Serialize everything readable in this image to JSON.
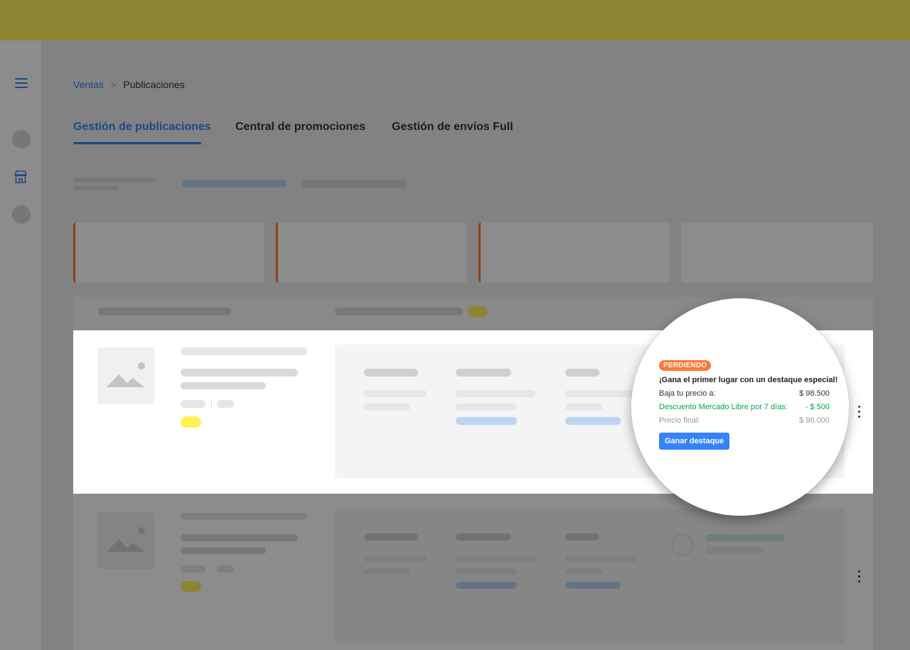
{
  "colors": {
    "topbar": "#fff159",
    "accent_blue": "#3483fa",
    "card_accent": "#ff7733",
    "success_green": "#00a650",
    "tag_yellow": "#fff159"
  },
  "sidebar": {
    "icons": [
      "menu-icon",
      "store-icon"
    ]
  },
  "breadcrumb": {
    "parent": "Ventas",
    "separator": ">",
    "current": "Publicaciones"
  },
  "tabs": [
    {
      "label": "Gestión de publicaciones",
      "active": true
    },
    {
      "label": "Central de promociones",
      "active": false
    },
    {
      "label": "Gestión de envíos Full",
      "active": false
    }
  ],
  "promo": {
    "status_badge": "PERDIENDO",
    "title": "¡Gana el primer lugar con un destaque especial!",
    "price_label": "Baja tu precio a:",
    "price_value": "$ 98.500",
    "discount_label": "Descuento Mercado Libre por 7 días:",
    "discount_value": "- $ 500",
    "final_label": "Precio final:",
    "final_value": "$ 98.000",
    "cta_label": "Ganar destaque"
  }
}
